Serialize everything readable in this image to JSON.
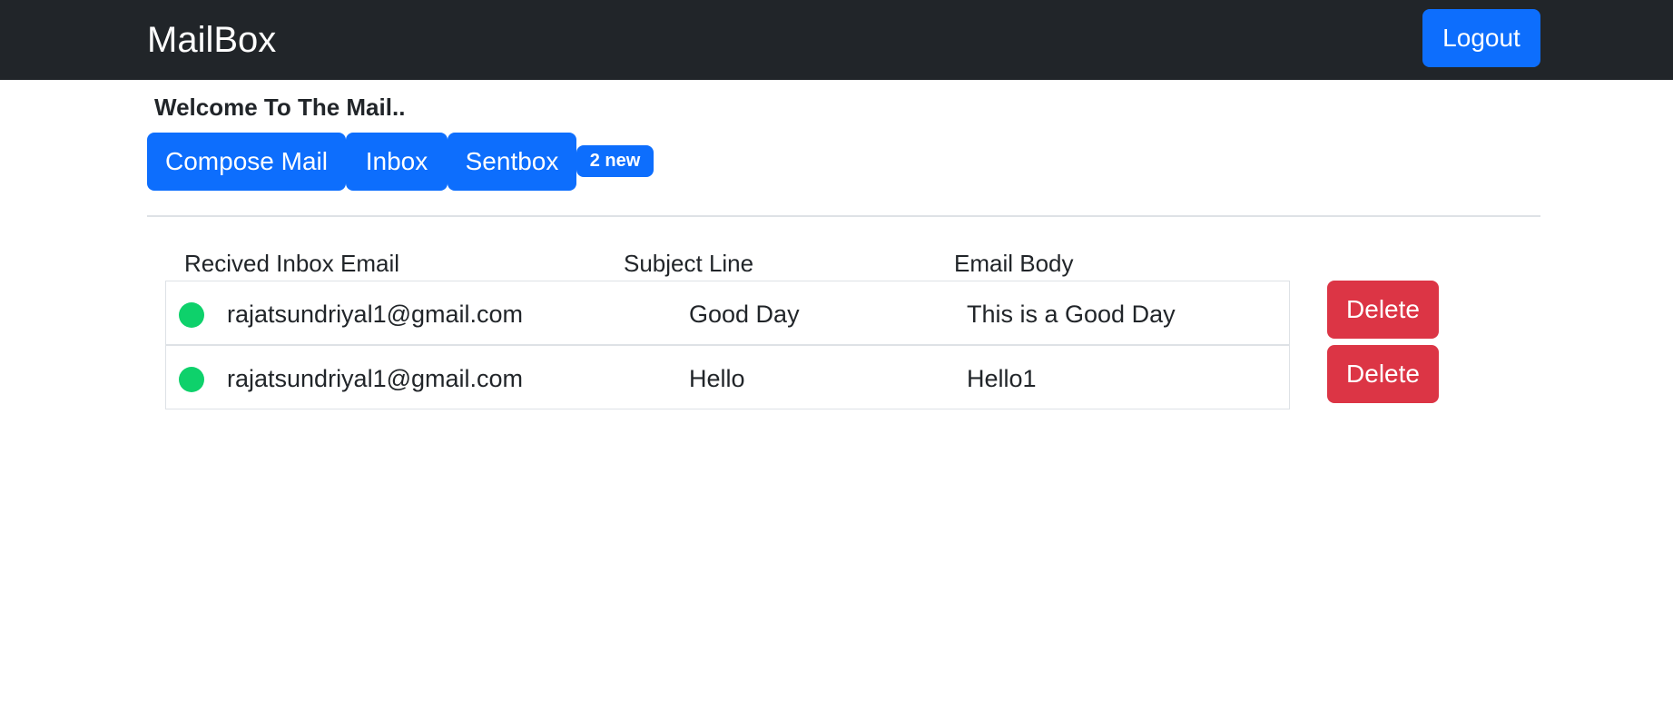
{
  "navbar": {
    "brand": "MailBox",
    "logout_label": "Logout"
  },
  "welcome_text": "Welcome To The Mail..",
  "nav_buttons": {
    "compose": "Compose Mail",
    "inbox": "Inbox",
    "sentbox": "Sentbox"
  },
  "badge": "2 new",
  "table": {
    "headers": [
      "Recived Inbox Email",
      "Subject Line",
      "Email Body"
    ],
    "rows": [
      {
        "email": "rajatsundriyal1@gmail.com",
        "subject": "Good Day",
        "body": "This is a Good Day",
        "status": "unread"
      },
      {
        "email": "rajatsundriyal1@gmail.com",
        "subject": "Hello",
        "body": "Hello1",
        "status": "unread"
      }
    ],
    "delete_label": "Delete"
  },
  "colors": {
    "navbar_bg": "#212529",
    "primary": "#0d6efd",
    "danger": "#dc3545",
    "unread_dot": "#0ed16b"
  }
}
